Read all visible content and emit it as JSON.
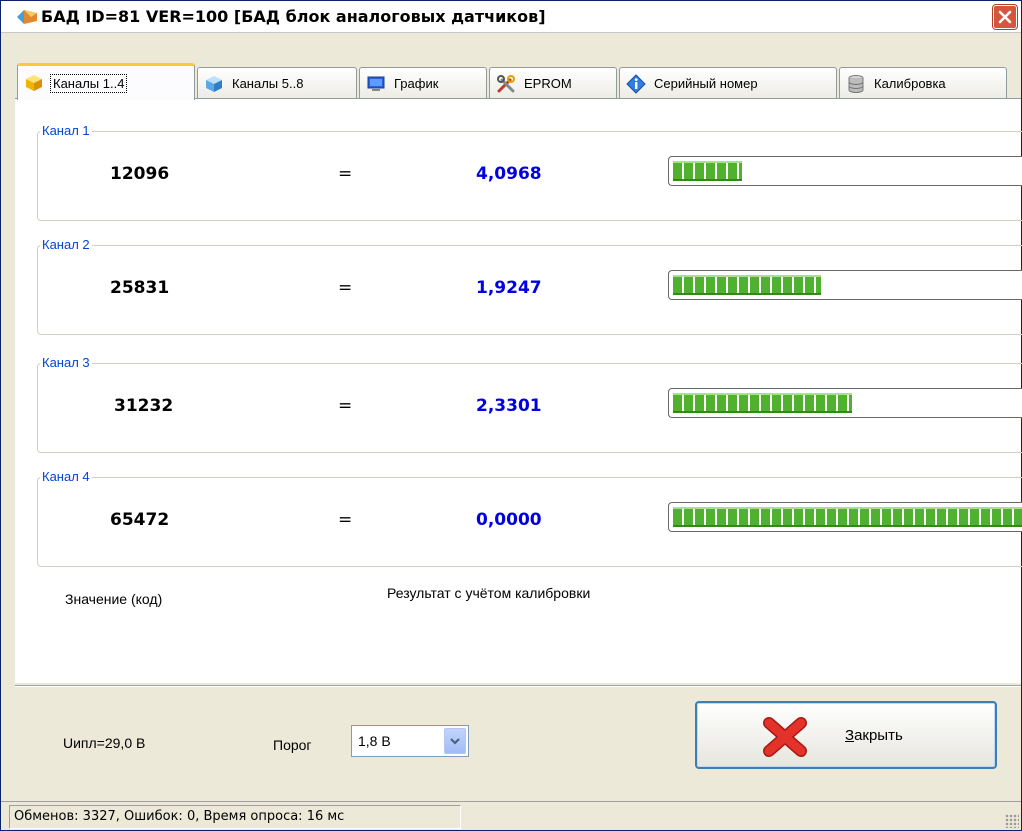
{
  "window": {
    "title": "БАД ID=81 VER=100 [БАД блок аналоговых датчиков]"
  },
  "tabs": [
    {
      "label": "Каналы 1..4",
      "icon": "cube-yellow-icon",
      "active": true
    },
    {
      "label": "Каналы 5..8",
      "icon": "cube-blue-icon",
      "active": false
    },
    {
      "label": "График",
      "icon": "monitor-icon",
      "active": false
    },
    {
      "label": "EPROM",
      "icon": "tools-icon",
      "active": false
    },
    {
      "label": "Серийный номер",
      "icon": "info-icon",
      "active": false
    },
    {
      "label": "Калибровка",
      "icon": "database-icon",
      "active": false
    }
  ],
  "channels": [
    {
      "title": "Канал 1",
      "code": "12096",
      "eq": "=",
      "value": "4,0968",
      "level": 0.185
    },
    {
      "title": "Канал 2",
      "code": "25831",
      "eq": "=",
      "value": "1,9247",
      "level": 0.394
    },
    {
      "title": "Канал 3",
      "code": "31232",
      "eq": "=",
      "value": "2,3301",
      "level": 0.477
    },
    {
      "title": "Канал 4",
      "code": "65472",
      "eq": "=",
      "value": "0,0000",
      "level": 1.0
    }
  ],
  "captions": {
    "code": "Значение (код)",
    "result": "Результат с учётом калибровки"
  },
  "bottom": {
    "upl": "Uипл=29,0 В",
    "porog_label": "Порог",
    "porog_value": "1,8 В",
    "close_label_accel": "З",
    "close_label_rest": "акрыть"
  },
  "status": {
    "text": "Обменов: 3327, Ошибок: 0, Время опроса: 16 мс"
  },
  "colors": {
    "value_blue": "#0000e0",
    "legend_blue": "#0046d5",
    "bar_green": "#4fb12d",
    "close_red": "#e2322a"
  }
}
